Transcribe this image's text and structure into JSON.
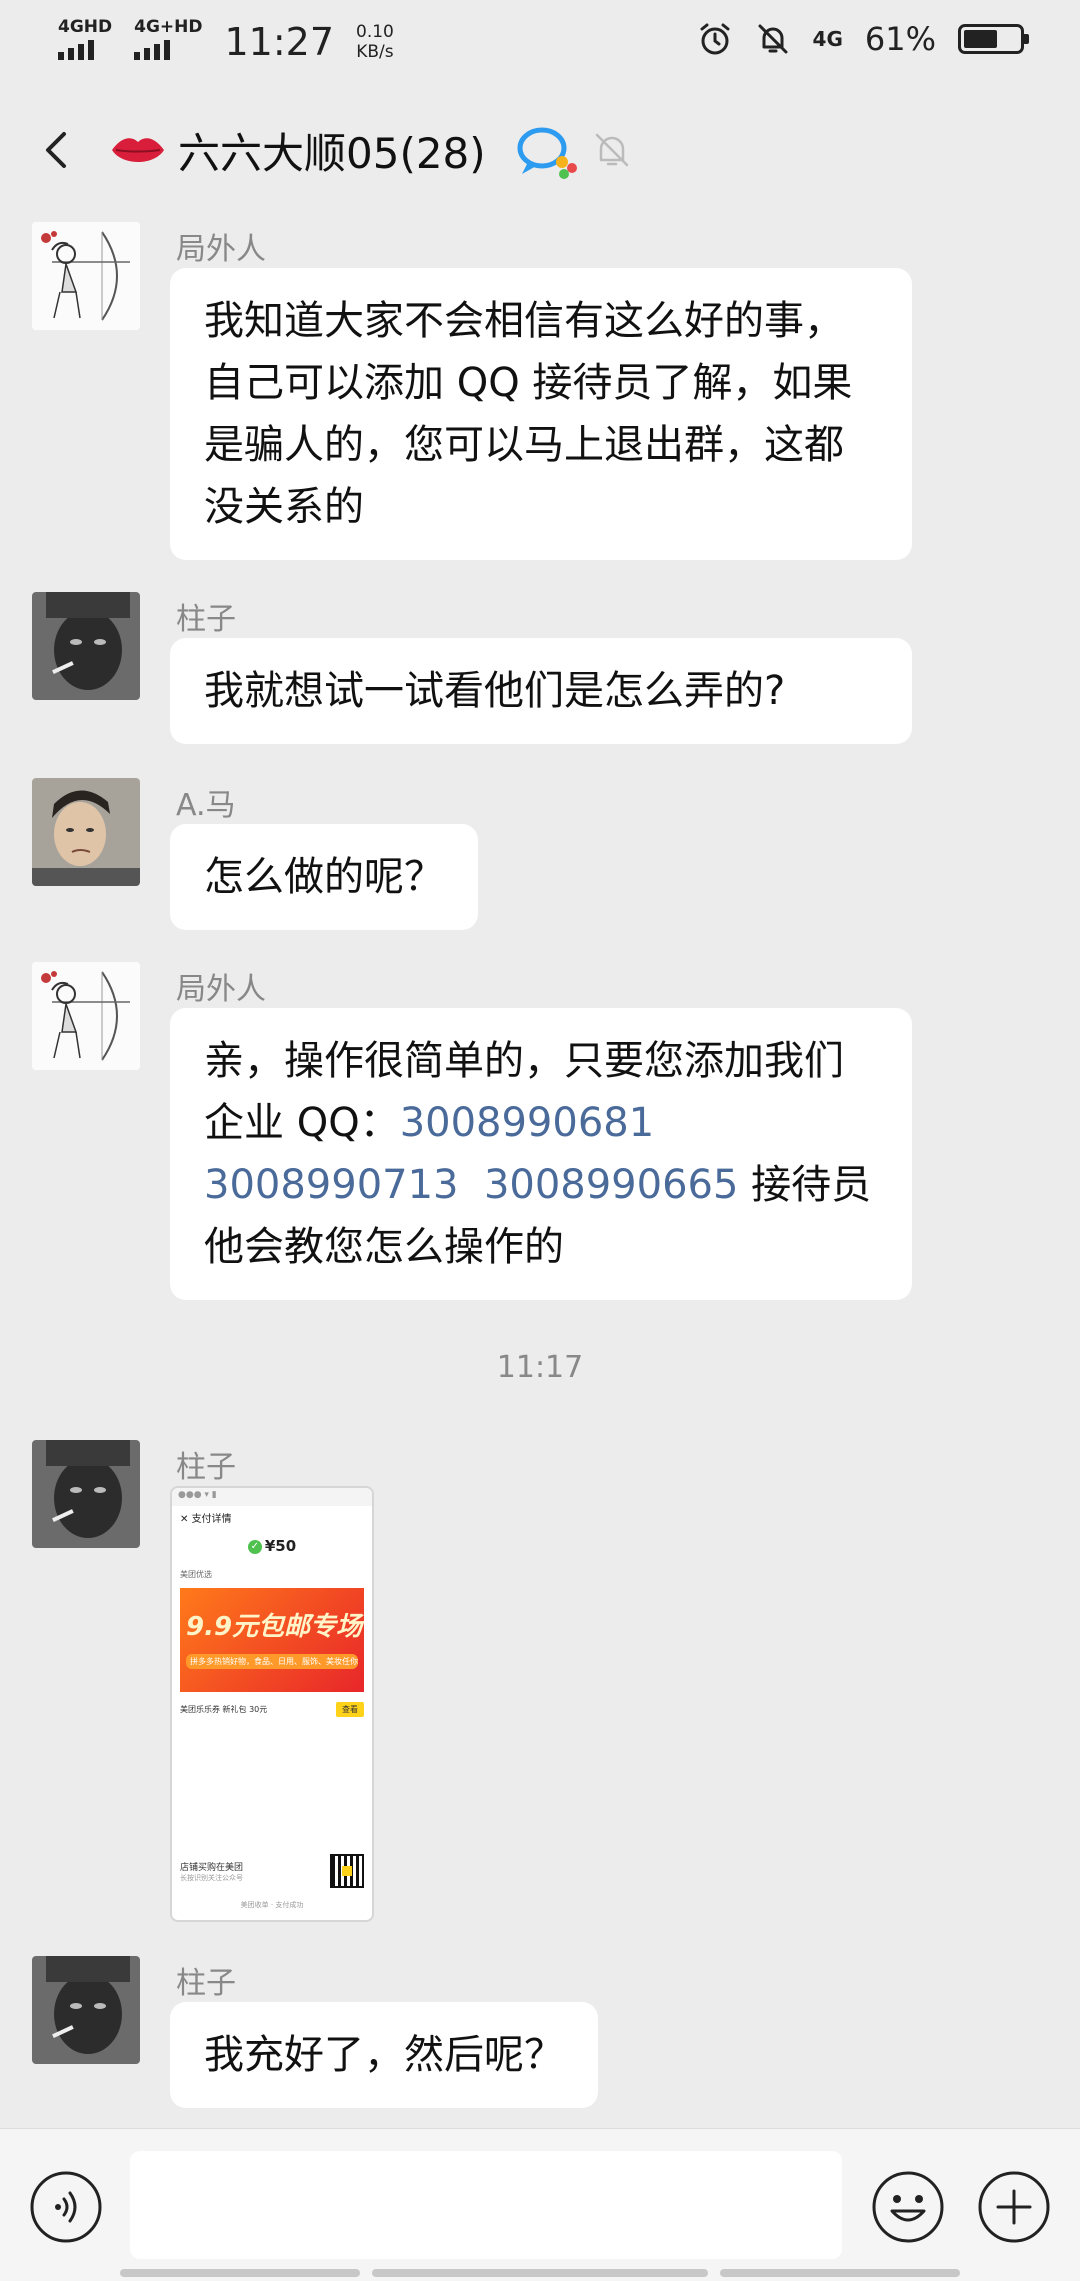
{
  "status_bar": {
    "net1": "4GHD",
    "net2": "4G+HD",
    "time": "11:27",
    "speed_value": "0.10",
    "speed_unit": "KB/s",
    "net3": "4G",
    "battery": "61%",
    "battery_level": 0.61,
    "icons": [
      "alarm-icon",
      "bell-off-icon"
    ]
  },
  "header": {
    "title": "六六大顺05(28)",
    "icons": [
      "back-icon",
      "lips-icon",
      "qq-group-icon",
      "mute-bell-icon"
    ]
  },
  "messages": [
    {
      "sender": "局外人",
      "avatar": "archer-girl-sketch",
      "text": "我知道大家不会相信有这么好的事，自己可以添加 QQ 接待员了解，如果是骗人的，您可以马上退出群，这都没关系的"
    },
    {
      "sender": "柱子",
      "avatar": "man-smoking-photo",
      "text": "我就想试一试看他们是怎么弄的?"
    },
    {
      "sender": "A.马",
      "avatar": "man-portrait-photo",
      "text": "怎么做的呢？"
    },
    {
      "sender": "局外人",
      "avatar": "archer-girl-sketch",
      "text_prefix": "亲，操作很简单的，只要您添加我们企业 QQ：",
      "qq_numbers": [
        "3008990681",
        "3008990713",
        "3008990665"
      ],
      "text_suffix": " 接待员他会教您怎么操作的"
    },
    {
      "timestamp": "11:17"
    },
    {
      "sender": "柱子",
      "avatar": "man-smoking-photo",
      "type": "image",
      "image": {
        "header": "支付详情",
        "amount": "¥50",
        "merchant": "美团优选",
        "banner_title": "9.9元包邮专场",
        "banner_sub": "拼多多热销好物，食品、日用、服饰、美妆任你选",
        "coupon_text": "美团乐乐券  新礼包  30元",
        "coupon_button": "查看",
        "footer_title": "店铺买购在美团",
        "footer_sub": "长按识别关注公众号",
        "bottom_text": "美团收单 · 支付成功"
      }
    },
    {
      "sender": "柱子",
      "avatar": "man-smoking-photo",
      "text": "我充好了，然后呢？"
    }
  ],
  "input_bar": {
    "placeholder": "",
    "icons": [
      "voice-icon",
      "emoji-icon",
      "plus-icon"
    ]
  }
}
